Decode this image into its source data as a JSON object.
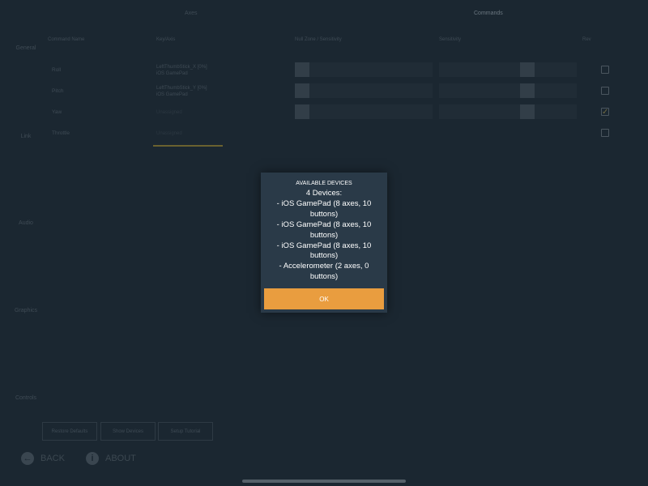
{
  "tabs": {
    "axes": "Axes",
    "commands": "Commands"
  },
  "sidebar": {
    "items": [
      "General",
      "Link",
      "Audio",
      "Graphics",
      "Controls"
    ]
  },
  "table": {
    "headers": {
      "command_name": "Command Name",
      "key_axis": "Key/Axis",
      "null_zone": "Null Zone / Sensitivity",
      "sensitivity": "Sensitivity",
      "rev": "Rev"
    },
    "rows": [
      {
        "name": "Roll",
        "key_line1": "LeftThumbStick_X [0%]",
        "key_line2": "iOS GamePad",
        "rev_checked": false
      },
      {
        "name": "Pitch",
        "key_line1": "LeftThumbStick_Y [0%]",
        "key_line2": "iOS GamePad",
        "rev_checked": false
      },
      {
        "name": "Yaw",
        "key_line1": "Unassigned",
        "key_line2": "",
        "rev_checked": true
      },
      {
        "name": "Throttle",
        "key_line1": "Unassigned",
        "key_line2": "",
        "rev_checked": false
      }
    ]
  },
  "bottom_buttons": {
    "restore_defaults": "Restore Defaults",
    "show_devices": "Show Devices",
    "setup_tutorial": "Setup Tutorial"
  },
  "nav": {
    "back": "BACK",
    "about": "ABOUT"
  },
  "dialog": {
    "title": "AVAILABLE DEVICES",
    "lines": [
      "4 Devices:",
      "- iOS GamePad (8 axes, 10",
      "buttons)",
      "- iOS GamePad (8 axes, 10",
      "buttons)",
      "- iOS GamePad (8 axes, 10",
      "buttons)",
      "- Accelerometer (2 axes, 0",
      "buttons)"
    ],
    "ok_label": "OK"
  },
  "colors": {
    "background": "#1b2731",
    "dialog": "#2a3a48",
    "accent": "#e99d3f"
  },
  "icons": {
    "back": "back-arrow-icon",
    "about": "info-icon",
    "rev_checked": "checkmark-icon"
  }
}
